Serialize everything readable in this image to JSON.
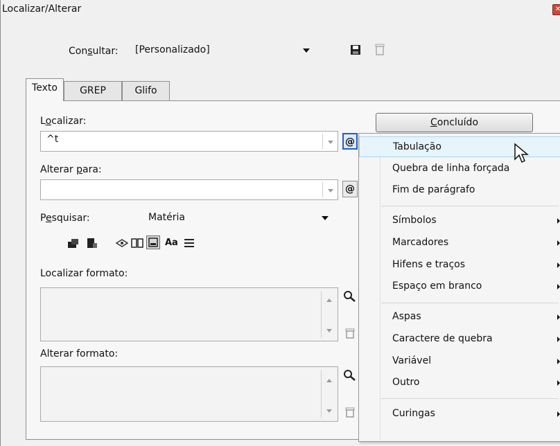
{
  "window": {
    "title": "Localizar/Alterar",
    "close_glyph": "✕"
  },
  "query": {
    "label_pre": "Con",
    "label_u": "s",
    "label_post": "ultar:",
    "value": "[Personalizado]"
  },
  "tabs": [
    {
      "label": "Texto"
    },
    {
      "label": "GREP"
    },
    {
      "label": "Glifo"
    }
  ],
  "find": {
    "label_pre": "L",
    "label_u": "o",
    "label_post": "calizar:",
    "value": "^t",
    "special_char_glyph": "@"
  },
  "change": {
    "label_pre": "Alterar ",
    "label_u": "p",
    "label_post": "ara:",
    "value": "",
    "special_char_glyph": "@"
  },
  "done_button": {
    "label_u": "C",
    "label_post": "oncluído"
  },
  "search": {
    "label_pre": "P",
    "label_u": "e",
    "label_post": "squisar:",
    "value": "Matéria"
  },
  "options_icons": {
    "case_label": "Aa"
  },
  "find_format": {
    "label": "Localizar formato:"
  },
  "change_format": {
    "label": "Alterar formato:"
  },
  "menu": {
    "items": [
      {
        "label": "Tabulação",
        "highlighted": true,
        "submenu": false
      },
      {
        "label": "Quebra de linha forçada",
        "submenu": false
      },
      {
        "label": "Fim de parágrafo",
        "submenu": false
      },
      {
        "label": "Símbolos",
        "submenu": true
      },
      {
        "label": "Marcadores",
        "submenu": true
      },
      {
        "label": "Hifens e traços",
        "submenu": true
      },
      {
        "label": "Espaço em branco",
        "submenu": true
      },
      {
        "label": "Aspas",
        "submenu": true
      },
      {
        "label": "Caractere de quebra",
        "submenu": true
      },
      {
        "label": "Variável",
        "submenu": true
      },
      {
        "label": "Outro",
        "submenu": true
      },
      {
        "label": "Curingas",
        "submenu": true
      }
    ]
  },
  "colors": {
    "highlight": "#e6f4fb",
    "close": "#c84a3c"
  }
}
